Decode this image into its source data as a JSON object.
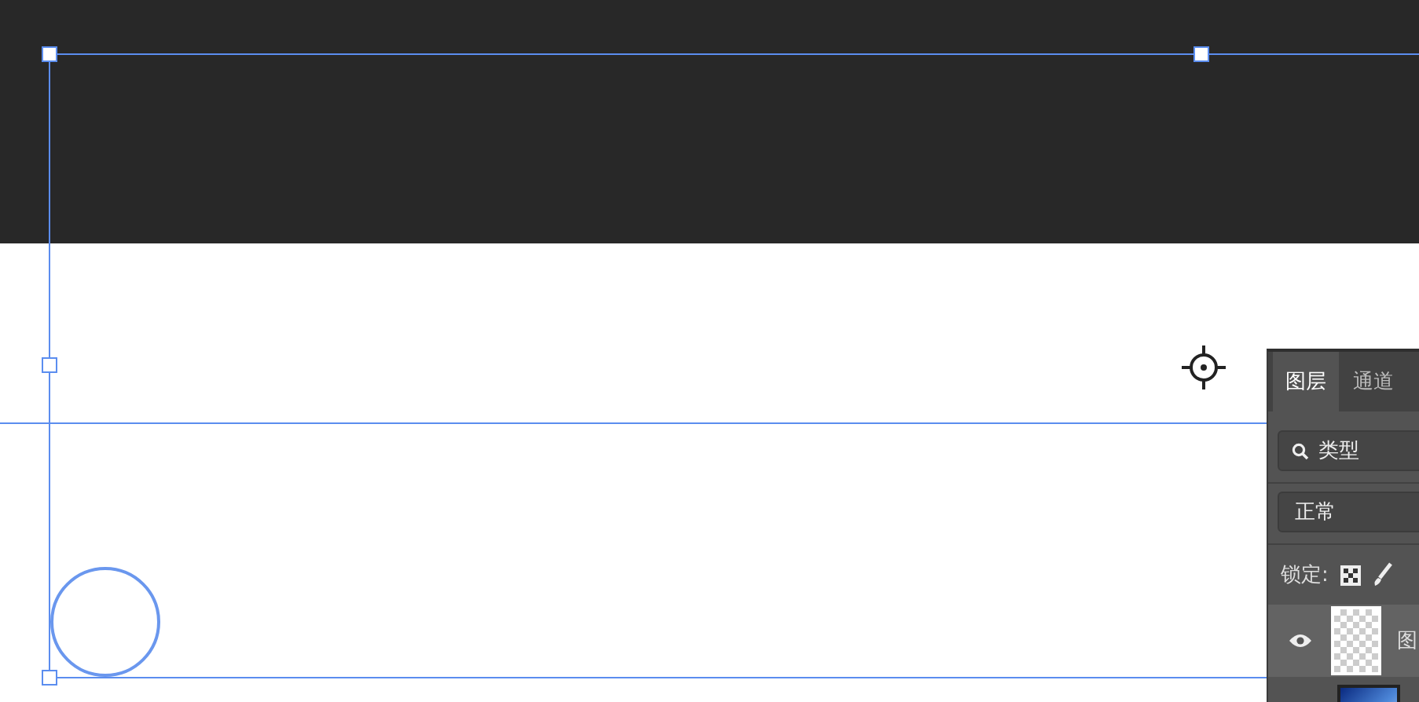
{
  "layers_panel": {
    "tabs": [
      {
        "label": "图层",
        "selected": true
      },
      {
        "label": "通道",
        "selected": false
      }
    ],
    "filter": "类型",
    "blend_mode": "正常",
    "lock_label": "锁定:",
    "layers": [
      {
        "name": "图",
        "selected": true,
        "visible": true,
        "kind": "transparent"
      },
      {
        "selected": false,
        "kind": "gradient"
      }
    ]
  }
}
